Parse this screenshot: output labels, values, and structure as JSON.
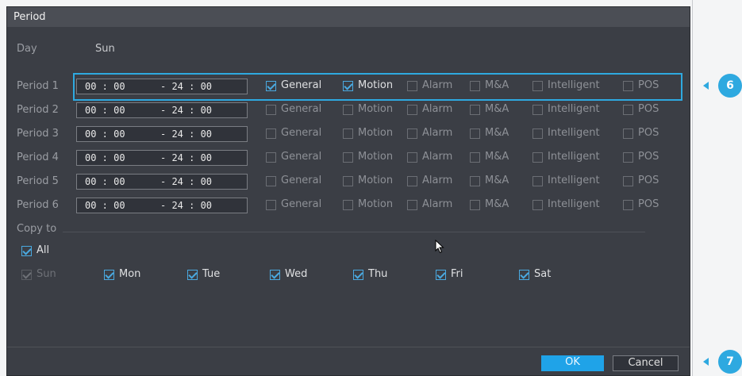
{
  "dialog": {
    "title": "Period",
    "day_label": "Day",
    "day_value": "Sun",
    "copy_to_label": "Copy to",
    "all_label": "All",
    "ok_label": "OK",
    "cancel_label": "Cancel"
  },
  "labels": {
    "general": "General",
    "motion": "Motion",
    "alarm": "Alarm",
    "ma": "M&A",
    "intelligent": "Intelligent",
    "pos": "POS"
  },
  "periods": [
    {
      "label": "Period 1",
      "start": "00 : 00",
      "end": "- 24 : 00",
      "general": true,
      "motion": true,
      "alarm": false,
      "ma": false,
      "intelligent": false,
      "pos": false
    },
    {
      "label": "Period 2",
      "start": "00 : 00",
      "end": "- 24 : 00",
      "general": false,
      "motion": false,
      "alarm": false,
      "ma": false,
      "intelligent": false,
      "pos": false
    },
    {
      "label": "Period 3",
      "start": "00 : 00",
      "end": "- 24 : 00",
      "general": false,
      "motion": false,
      "alarm": false,
      "ma": false,
      "intelligent": false,
      "pos": false
    },
    {
      "label": "Period 4",
      "start": "00 : 00",
      "end": "- 24 : 00",
      "general": false,
      "motion": false,
      "alarm": false,
      "ma": false,
      "intelligent": false,
      "pos": false
    },
    {
      "label": "Period 5",
      "start": "00 : 00",
      "end": "- 24 : 00",
      "general": false,
      "motion": false,
      "alarm": false,
      "ma": false,
      "intelligent": false,
      "pos": false
    },
    {
      "label": "Period 6",
      "start": "00 : 00",
      "end": "- 24 : 00",
      "general": false,
      "motion": false,
      "alarm": false,
      "ma": false,
      "intelligent": false,
      "pos": false
    }
  ],
  "copy_days": [
    {
      "label": "Sun",
      "checked": true,
      "disabled": true
    },
    {
      "label": "Mon",
      "checked": true,
      "disabled": false
    },
    {
      "label": "Tue",
      "checked": true,
      "disabled": false
    },
    {
      "label": "Wed",
      "checked": true,
      "disabled": false
    },
    {
      "label": "Thu",
      "checked": true,
      "disabled": false
    },
    {
      "label": "Fri",
      "checked": true,
      "disabled": false
    },
    {
      "label": "Sat",
      "checked": true,
      "disabled": false
    }
  ],
  "callouts": {
    "period_row": "6",
    "buttons": "7"
  },
  "colors": {
    "accent": "#2ea9e0",
    "dialog_bg": "#3b3e45"
  }
}
